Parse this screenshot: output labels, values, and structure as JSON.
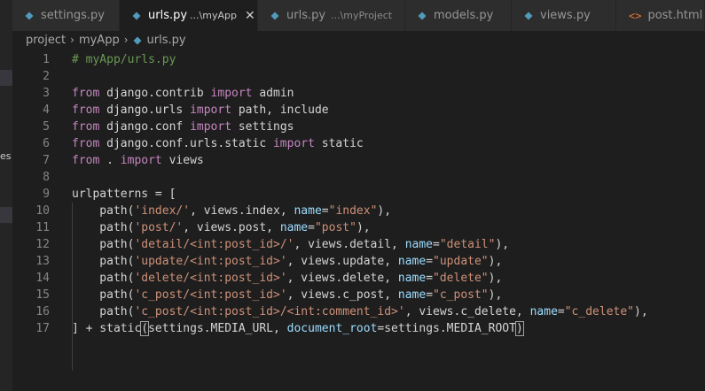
{
  "sidebar_strip": {
    "fragment": "es"
  },
  "tabs": [
    {
      "name": "settings.py",
      "description": "",
      "active": false,
      "icon": "python-file-icon"
    },
    {
      "name": "urls.py",
      "description": "...\\myApp",
      "active": true,
      "icon": "python-file-icon",
      "close": "✕"
    },
    {
      "name": "urls.py",
      "description": "...\\myProject",
      "active": false,
      "icon": "python-file-icon"
    },
    {
      "name": "models.py",
      "description": "",
      "active": false,
      "icon": "python-file-icon"
    },
    {
      "name": "views.py",
      "description": "",
      "active": false,
      "icon": "python-file-icon"
    },
    {
      "name": "post.html",
      "description": "",
      "active": false,
      "icon": "html-file-icon"
    }
  ],
  "breadcrumb": [
    "project",
    "myApp",
    "urls.py"
  ],
  "colors": {
    "python_icon": "#519aba",
    "html_icon": "#e37933",
    "keyword": "#c586c0",
    "string": "#ce9178",
    "comment": "#6a9955",
    "parameter": "#9cdcfe"
  },
  "code_lines": [
    {
      "n": "1",
      "t": [
        [
          "cm",
          "# myApp/urls.py"
        ]
      ]
    },
    {
      "n": "2",
      "t": []
    },
    {
      "n": "3",
      "t": [
        [
          "kw",
          "from"
        ],
        [
          "p",
          " django.contrib "
        ],
        [
          "kw",
          "import"
        ],
        [
          "p",
          " admin"
        ]
      ]
    },
    {
      "n": "4",
      "t": [
        [
          "kw",
          "from"
        ],
        [
          "p",
          " django.urls "
        ],
        [
          "kw",
          "import"
        ],
        [
          "p",
          " path, include"
        ]
      ]
    },
    {
      "n": "5",
      "t": [
        [
          "kw",
          "from"
        ],
        [
          "p",
          " django.conf "
        ],
        [
          "kw",
          "import"
        ],
        [
          "p",
          " settings"
        ]
      ]
    },
    {
      "n": "6",
      "t": [
        [
          "kw",
          "from"
        ],
        [
          "p",
          " django.conf.urls.static "
        ],
        [
          "kw",
          "import"
        ],
        [
          "p",
          " static"
        ]
      ]
    },
    {
      "n": "7",
      "t": [
        [
          "kw",
          "from"
        ],
        [
          "p",
          " . "
        ],
        [
          "kw",
          "import"
        ],
        [
          "p",
          " views"
        ]
      ]
    },
    {
      "n": "8",
      "t": []
    },
    {
      "n": "9",
      "t": [
        [
          "p",
          "urlpatterns = ["
        ]
      ]
    },
    {
      "n": "10",
      "t": [
        [
          "p",
          "    path("
        ],
        [
          "str",
          "'index/'"
        ],
        [
          "p",
          ", views.index, "
        ],
        [
          "param",
          "name"
        ],
        [
          "p",
          "="
        ],
        [
          "str",
          "\"index\""
        ],
        [
          "p",
          "),"
        ]
      ]
    },
    {
      "n": "11",
      "t": [
        [
          "p",
          "    path("
        ],
        [
          "str",
          "'post/'"
        ],
        [
          "p",
          ", views.post, "
        ],
        [
          "param",
          "name"
        ],
        [
          "p",
          "="
        ],
        [
          "str",
          "\"post\""
        ],
        [
          "p",
          "),"
        ]
      ]
    },
    {
      "n": "12",
      "t": [
        [
          "p",
          "    path("
        ],
        [
          "str",
          "'detail/<int:post_id>/'"
        ],
        [
          "p",
          ", views.detail, "
        ],
        [
          "param",
          "name"
        ],
        [
          "p",
          "="
        ],
        [
          "str",
          "\"detail\""
        ],
        [
          "p",
          "),"
        ]
      ]
    },
    {
      "n": "13",
      "t": [
        [
          "p",
          "    path("
        ],
        [
          "str",
          "'update/<int:post_id>'"
        ],
        [
          "p",
          ", views.update, "
        ],
        [
          "param",
          "name"
        ],
        [
          "p",
          "="
        ],
        [
          "str",
          "\"update\""
        ],
        [
          "p",
          "),"
        ]
      ]
    },
    {
      "n": "14",
      "t": [
        [
          "p",
          "    path("
        ],
        [
          "str",
          "'delete/<int:post_id>'"
        ],
        [
          "p",
          ", views.delete, "
        ],
        [
          "param",
          "name"
        ],
        [
          "p",
          "="
        ],
        [
          "str",
          "\"delete\""
        ],
        [
          "p",
          "),"
        ]
      ]
    },
    {
      "n": "15",
      "t": [
        [
          "p",
          "    path("
        ],
        [
          "str",
          "'c_post/<int:post_id>'"
        ],
        [
          "p",
          ", views.c_post, "
        ],
        [
          "param",
          "name"
        ],
        [
          "p",
          "="
        ],
        [
          "str",
          "\"c_post\""
        ],
        [
          "p",
          "),"
        ]
      ]
    },
    {
      "n": "16",
      "t": [
        [
          "p",
          "    path("
        ],
        [
          "str",
          "'c_post/<int:post_id>/<int:comment_id>'"
        ],
        [
          "p",
          ", views.c_delete, "
        ],
        [
          "param",
          "name"
        ],
        [
          "p",
          "="
        ],
        [
          "str",
          "\"c_delete\""
        ],
        [
          "p",
          "),"
        ]
      ]
    },
    {
      "n": "17",
      "t": [
        [
          "p",
          "] + static"
        ],
        [
          "br",
          "("
        ],
        [
          "p",
          "settings.MEDIA_URL, "
        ],
        [
          "param",
          "document_root"
        ],
        [
          "p",
          "=settings.MEDIA_ROOT"
        ],
        [
          "br",
          ")"
        ]
      ]
    }
  ]
}
